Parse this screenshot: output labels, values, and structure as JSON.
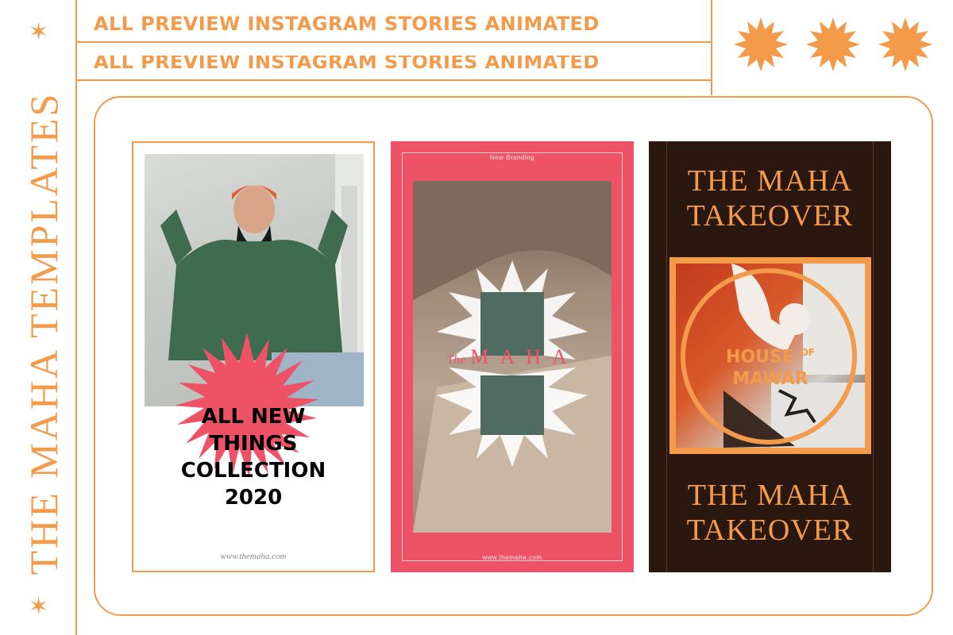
{
  "brand": {
    "vertical_title": "THE MAHA TEMPLATES"
  },
  "header": {
    "headline": "ALL PREVIEW INSTAGRAM STORIES ANIMATED",
    "headline_echo": "ALL PREVIEW INSTAGRAM STORIES ANIMATED"
  },
  "colors": {
    "accent": "#f39a4b",
    "pink": "#ee5267",
    "dark": "#2a170f"
  },
  "stories": [
    {
      "title_lines": [
        "ALL NEW",
        "THINGS",
        "COLLECTION",
        "2020"
      ],
      "url": "www.themaha.com"
    },
    {
      "top_text": "New Branding",
      "logo_the": "The",
      "logo_word": "MAHA",
      "url": "www.themaha.com"
    },
    {
      "heading_top_1": "THE MAHA",
      "heading_top_2": "TAKEOVER",
      "label_1": "HOUSE",
      "label_of": "OF",
      "label_2": "MAWAR",
      "heading_bottom_1": "THE MAHA",
      "heading_bottom_2": "TAKEOVER"
    }
  ]
}
